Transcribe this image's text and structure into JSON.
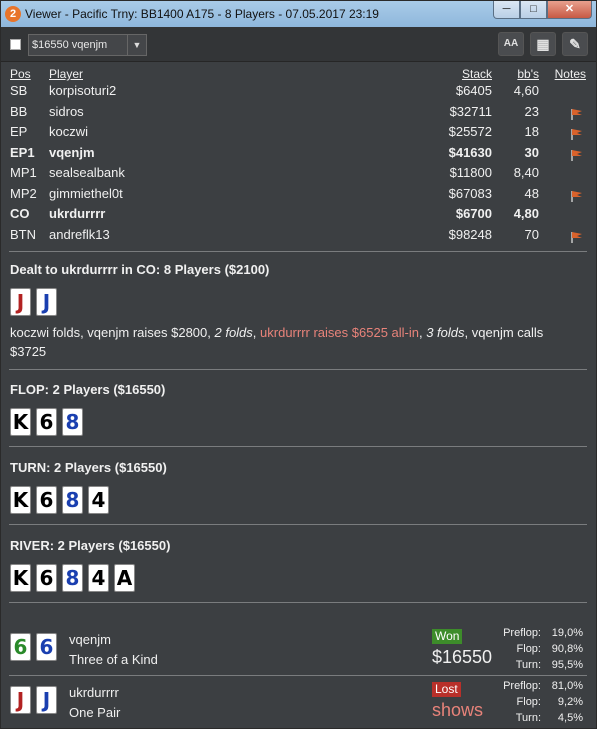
{
  "window": {
    "title": "Viewer - Pacific Trny: BB1400 A175 - 8 Players - 07.05.2017 23:19",
    "app_icon_glyph": "2",
    "minimize_glyph": "─",
    "maximize_glyph": "□",
    "close_glyph": "✕"
  },
  "toolbar": {
    "hand_select_value": "$16550 vqenjm",
    "font_button_label": "AA",
    "grid_icon_glyph": "▦",
    "edit_icon_glyph": "✎"
  },
  "players_table": {
    "headers": {
      "pos": "Pos",
      "player": "Player",
      "stack": "Stack",
      "bbs": "bb's",
      "notes": "Notes"
    },
    "rows": [
      {
        "pos": "SB",
        "player": "korpisoturi2",
        "stack": "$6405",
        "bbs": "4,60",
        "note": false,
        "bold": false
      },
      {
        "pos": "BB",
        "player": "sidros",
        "stack": "$32711",
        "bbs": "23",
        "note": true,
        "bold": false
      },
      {
        "pos": "EP",
        "player": "koczwi",
        "stack": "$25572",
        "bbs": "18",
        "note": true,
        "bold": false
      },
      {
        "pos": "EP1",
        "player": "vqenjm",
        "stack": "$41630",
        "bbs": "30",
        "note": true,
        "bold": true
      },
      {
        "pos": "MP1",
        "player": "sealsealbank",
        "stack": "$11800",
        "bbs": "8,40",
        "note": false,
        "bold": false
      },
      {
        "pos": "MP2",
        "player": "gimmiethel0t",
        "stack": "$67083",
        "bbs": "48",
        "note": true,
        "bold": false
      },
      {
        "pos": "CO",
        "player": "ukrdurrrr",
        "stack": "$6700",
        "bbs": "4,80",
        "note": false,
        "bold": true
      },
      {
        "pos": "BTN",
        "player": "andreflk13",
        "stack": "$98248",
        "bbs": "70",
        "note": true,
        "bold": false
      }
    ]
  },
  "preflop": {
    "header": "Dealt to ukrdurrrr in CO: 8 Players ($2100)",
    "cards": [
      {
        "rank": "J",
        "color": "#b22222"
      },
      {
        "rank": "J",
        "color": "#1a3fb0"
      }
    ],
    "action_1": "koczwi folds, vqenjm raises $2800, ",
    "action_2": "2 folds",
    "action_3": ", ",
    "action_4": "ukrdurrrr raises $6525 all-in",
    "action_5": ", ",
    "action_6": "3 folds",
    "action_7": ", vqenjm calls $3725"
  },
  "flop": {
    "header": "FLOP: 2 Players ($16550)",
    "cards": [
      {
        "rank": "K",
        "color": "#000000"
      },
      {
        "rank": "6",
        "color": "#000000"
      },
      {
        "rank": "8",
        "color": "#1a3fb0"
      }
    ]
  },
  "turn": {
    "header": "TURN: 2 Players ($16550)",
    "cards": [
      {
        "rank": "K",
        "color": "#000000"
      },
      {
        "rank": "6",
        "color": "#000000"
      },
      {
        "rank": "8",
        "color": "#1a3fb0"
      },
      {
        "rank": "4",
        "color": "#000000"
      }
    ]
  },
  "river": {
    "header": "RIVER: 2 Players ($16550)",
    "cards": [
      {
        "rank": "K",
        "color": "#000000"
      },
      {
        "rank": "6",
        "color": "#000000"
      },
      {
        "rank": "8",
        "color": "#1a3fb0"
      },
      {
        "rank": "4",
        "color": "#000000"
      },
      {
        "rank": "A",
        "color": "#000000"
      }
    ]
  },
  "results": [
    {
      "player": "vqenjm",
      "hand": "Three of a Kind",
      "badge": "Won",
      "badge_color": "#3d8c2a",
      "amount": "$16550",
      "amount_color": "#f0f0f0",
      "cards": [
        {
          "rank": "6",
          "color": "#2a8a2a"
        },
        {
          "rank": "6",
          "color": "#1a3fb0"
        }
      ],
      "equity": [
        {
          "label": "Preflop:",
          "value": "19,0%"
        },
        {
          "label": "Flop:",
          "value": "90,8%"
        },
        {
          "label": "Turn:",
          "value": "95,5%"
        }
      ]
    },
    {
      "player": "ukrdurrrr",
      "hand": "One Pair",
      "badge": "Lost",
      "badge_color": "#b8302a",
      "amount": "shows",
      "amount_color": "#e8837a",
      "cards": [
        {
          "rank": "J",
          "color": "#b22222"
        },
        {
          "rank": "J",
          "color": "#1a3fb0"
        }
      ],
      "equity": [
        {
          "label": "Preflop:",
          "value": "81,0%"
        },
        {
          "label": "Flop:",
          "value": "9,2%"
        },
        {
          "label": "Turn:",
          "value": "4,5%"
        }
      ]
    }
  ]
}
